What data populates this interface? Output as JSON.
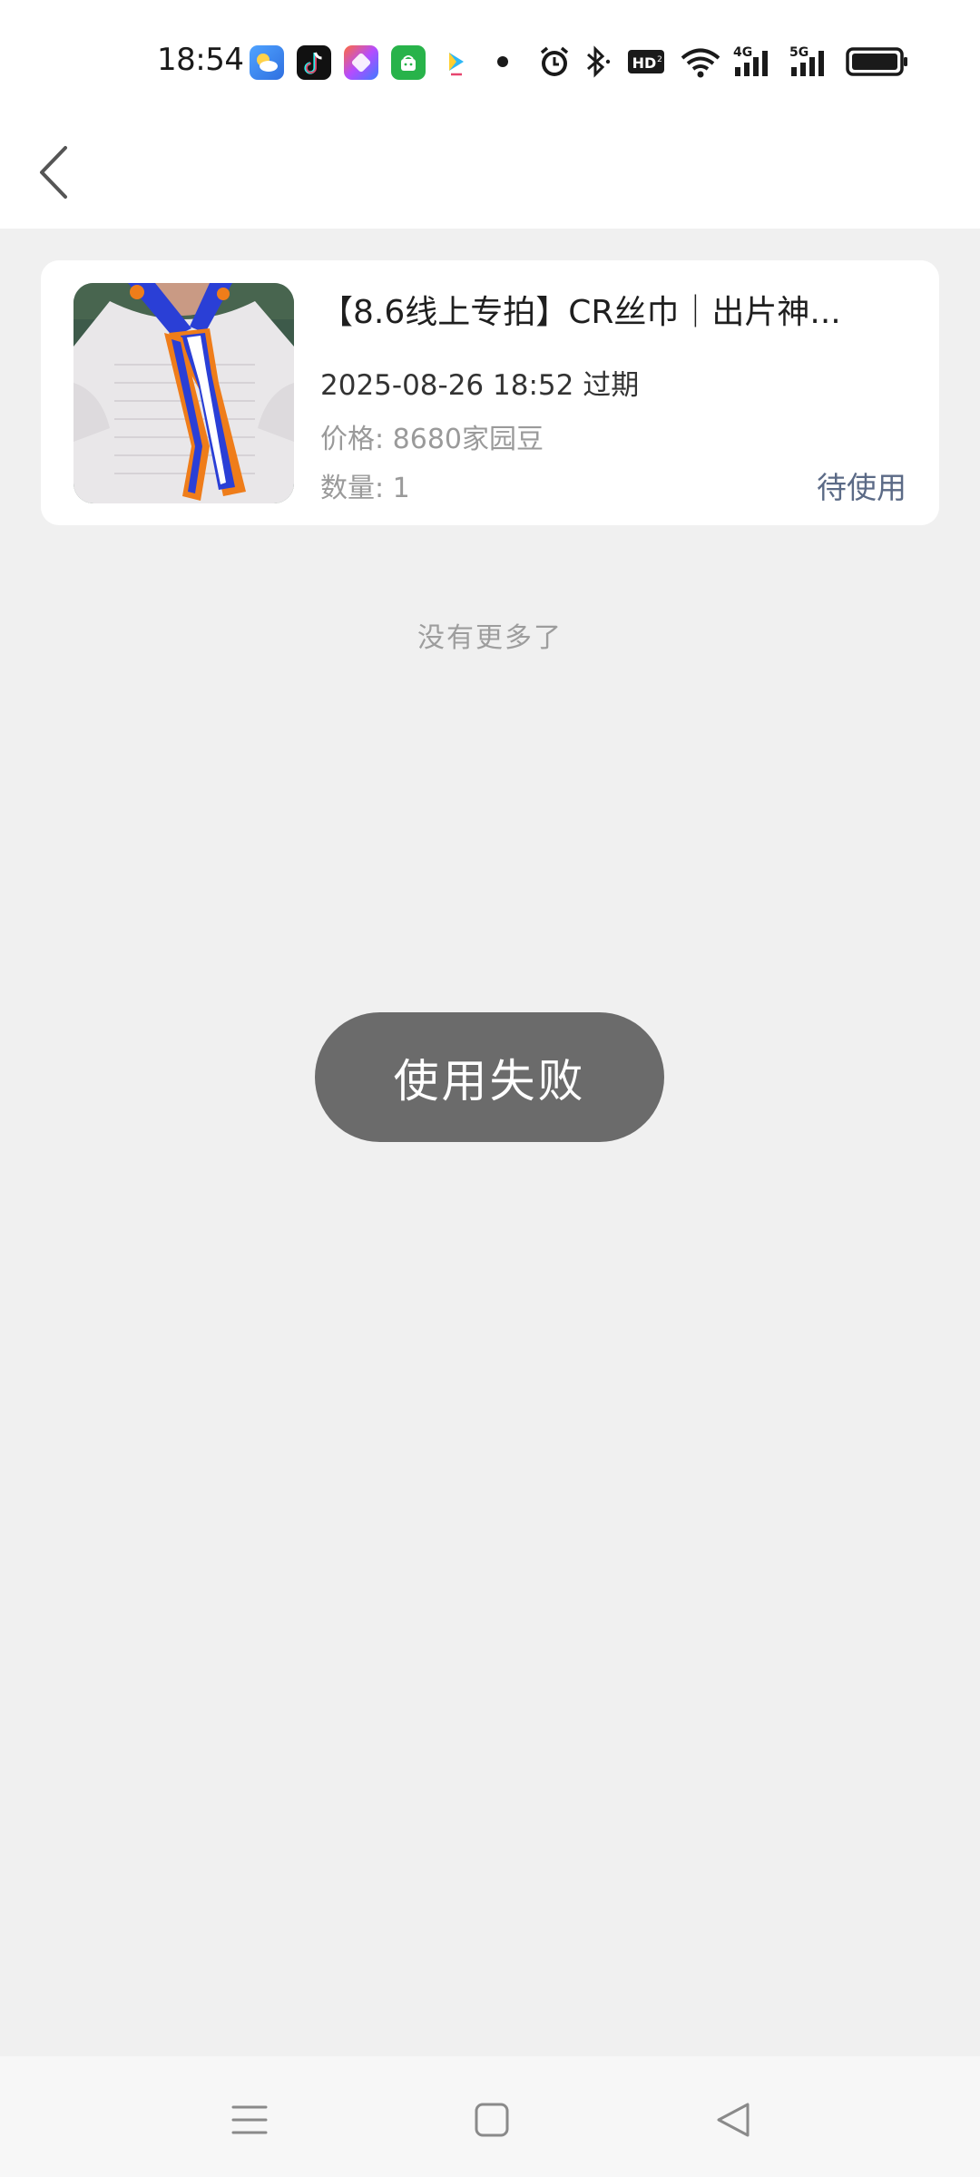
{
  "status_bar": {
    "time": "18:54",
    "app_icons": [
      "weather-app-icon",
      "tiktok-icon",
      "creative-app-icon",
      "android-store-icon",
      "video-app-icon"
    ],
    "indicators": [
      "notification-dot-icon",
      "alarm-icon",
      "bluetooth-icon",
      "hd-voice-icon",
      "wifi-icon",
      "4g-signal-icon",
      "5g-signal-icon",
      "battery-icon"
    ],
    "hd_label": "HD",
    "net_4g_label": "4G",
    "net_5g_label": "5G"
  },
  "header": {
    "back_icon": "chevron-left-icon"
  },
  "order": {
    "title": "【8.6线上专拍】CR丝巾｜出片神...",
    "expire_date": "2025-08-26 18:52",
    "expire_suffix": "过期",
    "price_label": "价格:",
    "price_value": "8680",
    "price_unit": "家园豆",
    "quantity_label": "数量:",
    "quantity_value": "1",
    "status": "待使用",
    "image_icon": "product-photo-scarf"
  },
  "list_footer": {
    "no_more": "没有更多了"
  },
  "toast": {
    "message": "使用失败"
  },
  "nav_bar": {
    "menu_icon": "menu-icon",
    "home_icon": "home-square-icon",
    "back_icon": "back-triangle-icon"
  },
  "colors": {
    "background": "#f0f0f0",
    "card": "#ffffff",
    "status_accent": "#5b6a86",
    "toast_bg": "#6b6b6b"
  }
}
